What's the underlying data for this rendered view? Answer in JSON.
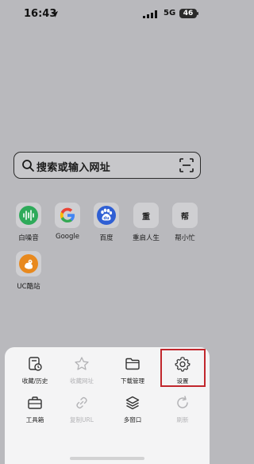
{
  "status_bar": {
    "time": "16:43",
    "network": "5G",
    "battery": "46"
  },
  "search": {
    "placeholder": "搜索或输入网址",
    "search_icon": "search-icon",
    "scan_icon": "scan-icon"
  },
  "shortcuts": [
    {
      "label": "白噪音",
      "icon": "white-noise-icon"
    },
    {
      "label": "Google",
      "icon": "google-icon"
    },
    {
      "label": "百度",
      "icon": "baidu-icon"
    },
    {
      "label": "重启人生",
      "tile_text": "重",
      "icon": "letter-tile"
    },
    {
      "label": "帮小忙",
      "tile_text": "帮",
      "icon": "letter-tile"
    },
    {
      "label": "UC酷站",
      "icon": "uc-squirrel-icon"
    }
  ],
  "menu": {
    "items": [
      {
        "label": "收藏/历史",
        "icon": "history-icon",
        "enabled": true
      },
      {
        "label": "收藏网址",
        "icon": "star-icon",
        "enabled": false
      },
      {
        "label": "下载管理",
        "icon": "folder-icon",
        "enabled": true
      },
      {
        "label": "设置",
        "icon": "gear-icon",
        "enabled": true,
        "highlighted": true
      },
      {
        "label": "工具箱",
        "icon": "toolbox-icon",
        "enabled": true
      },
      {
        "label": "复制URL",
        "icon": "link-icon",
        "enabled": false
      },
      {
        "label": "多窗口",
        "icon": "layers-icon",
        "enabled": true
      },
      {
        "label": "刷新",
        "icon": "refresh-icon",
        "enabled": false
      }
    ]
  },
  "colors": {
    "background": "#b9b9bd",
    "menu_panel": "#f4f4f5",
    "highlight": "#c1272d",
    "white_noise_green": "#2eaa5a",
    "baidu_blue": "#2f5fd4",
    "uc_orange": "#e8891e"
  }
}
